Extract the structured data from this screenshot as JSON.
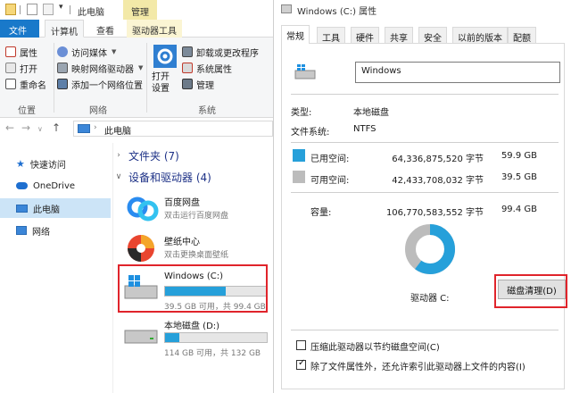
{
  "explorer": {
    "title": "此电脑",
    "contextual_tab": "管理",
    "tabs": [
      "文件",
      "计算机",
      "查看",
      "驱动器工具"
    ],
    "ribbon": {
      "location": {
        "label": "位置",
        "items": [
          "属性",
          "打开",
          "重命名"
        ]
      },
      "network": {
        "label": "网络",
        "items": [
          "访问媒体",
          "映射网络驱动器",
          "添加一个网络位置"
        ]
      },
      "system": {
        "label": "系统",
        "open_settings": "打开\n设置",
        "items": [
          "卸载或更改程序",
          "系统属性",
          "管理"
        ]
      }
    },
    "address": "此电脑",
    "nav": [
      "快速访问",
      "OneDrive",
      "此电脑",
      "网络"
    ],
    "sections": {
      "folders": "文件夹 (7)",
      "devices": "设备和驱动器 (4)"
    },
    "devices": [
      {
        "name": "百度网盘",
        "sub": "双击运行百度网盘"
      },
      {
        "name": "壁纸中心",
        "sub": "双击更换桌面壁纸"
      }
    ],
    "drives": [
      {
        "name": "Windows (C:)",
        "free": "39.5 GB 可用，共 99.4 GB",
        "used_fraction": 0.6
      },
      {
        "name": "本地磁盘 (D:)",
        "free": "114 GB 可用，共 132 GB",
        "used_fraction": 0.14
      }
    ]
  },
  "props": {
    "title": "Windows (C:) 属性",
    "tabs": [
      "常规",
      "工具",
      "硬件",
      "共享",
      "安全",
      "以前的版本",
      "配额"
    ],
    "volume_name": "Windows",
    "type_label": "类型:",
    "type_value": "本地磁盘",
    "fs_label": "文件系统:",
    "fs_value": "NTFS",
    "used": {
      "label": "已用空间:",
      "bytes": "64,336,875,520 字节",
      "size": "59.9 GB",
      "color": "#26a0da"
    },
    "free": {
      "label": "可用空间:",
      "bytes": "42,433,708,032 字节",
      "size": "39.5 GB",
      "color": "#bcbcbc"
    },
    "capacity": {
      "label": "容量:",
      "bytes": "106,770,583,552 字节",
      "size": "99.4 GB"
    },
    "used_fraction": 0.6025,
    "drive_label": "驱动器 C:",
    "cleanup_button": "磁盘清理(D)",
    "compress_label": "压缩此驱动器以节约磁盘空间(C)",
    "index_label": "除了文件属性外，还允许索引此驱动器上文件的内容(I)"
  }
}
